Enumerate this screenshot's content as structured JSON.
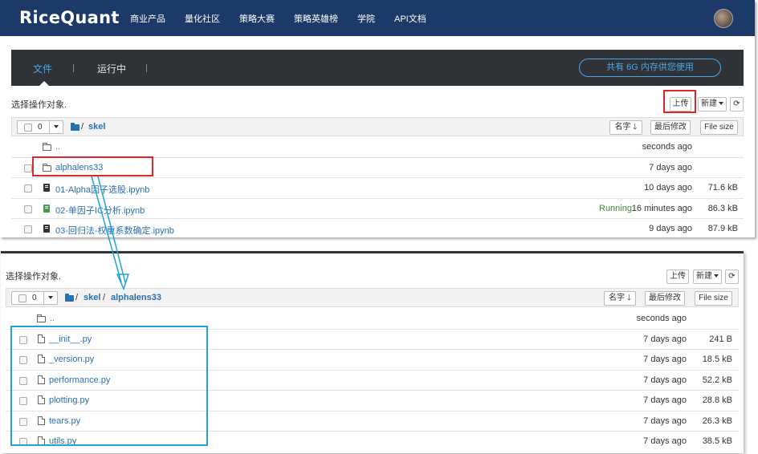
{
  "brand": {
    "name": "RiceQuant"
  },
  "nav": {
    "items": [
      "商业产品",
      "量化社区",
      "策略大赛",
      "策略英雄榜",
      "学院",
      "API文档"
    ]
  },
  "tabs": [
    {
      "label": "文件",
      "active": true
    },
    {
      "label": "运行中",
      "active": false
    }
  ],
  "memory_notice": "共有 6G 内存供您使用",
  "top": {
    "select_prompt": "选择操作对象.",
    "upload_label": "上传",
    "new_label": "新建",
    "selected_count": "0",
    "breadcrumb": [
      "/",
      "skel"
    ],
    "sort_name": "名字",
    "sort_modified": "最后修改",
    "sort_size": "File size",
    "rows": [
      {
        "type": "up",
        "name": "..",
        "status": "",
        "time": "seconds ago",
        "size": ""
      },
      {
        "type": "folder",
        "name": "alphalens33",
        "status": "",
        "time": "7 days ago",
        "size": ""
      },
      {
        "type": "notebook",
        "name": "01-Alpha因子选股.ipynb",
        "status": "",
        "time": "10 days ago",
        "size": "71.6 kB"
      },
      {
        "type": "notebook-running",
        "name": "02-单因子IC分析.ipynb",
        "status": "Running",
        "time": "16 minutes ago",
        "size": "86.3 kB"
      },
      {
        "type": "notebook",
        "name": "03-回归法-权重系数确定.ipynb",
        "status": "",
        "time": "9 days ago",
        "size": "87.9 kB"
      }
    ]
  },
  "bottom": {
    "select_prompt": "选择操作对象.",
    "upload_label": "上传",
    "new_label": "新建",
    "selected_count": "0",
    "breadcrumb": [
      "/",
      "skel",
      "/",
      "alphalens33"
    ],
    "sort_name": "名字",
    "sort_modified": "最后修改",
    "sort_size": "File size",
    "rows": [
      {
        "type": "up",
        "name": "..",
        "time": "seconds ago",
        "size": ""
      },
      {
        "type": "file",
        "name": "__init__.py",
        "time": "7 days ago",
        "size": "241 B"
      },
      {
        "type": "file",
        "name": "_version.py",
        "time": "7 days ago",
        "size": "18.5 kB"
      },
      {
        "type": "file",
        "name": "performance.py",
        "time": "7 days ago",
        "size": "52.2 kB"
      },
      {
        "type": "file",
        "name": "plotting.py",
        "time": "7 days ago",
        "size": "28.8 kB"
      },
      {
        "type": "file",
        "name": "tears.py",
        "time": "7 days ago",
        "size": "26.3 kB"
      },
      {
        "type": "file",
        "name": "utils.py",
        "time": "7 days ago",
        "size": "38.5 kB"
      }
    ]
  },
  "colors": {
    "navbar": "#1b3a68",
    "tabs_bar": "#2f3237",
    "link": "#2a6fb0",
    "accent": "#4aa8e8",
    "highlight_red": "#e0262b",
    "highlight_blue": "#1fa3d8",
    "running": "#3c8c3c"
  }
}
